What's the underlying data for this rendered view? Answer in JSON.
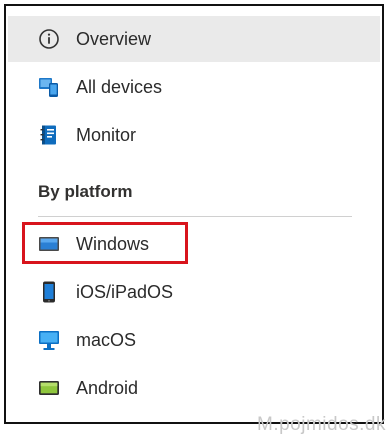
{
  "nav": {
    "items": [
      {
        "label": "Overview",
        "icon": "info-icon",
        "selected": true
      },
      {
        "label": "All devices",
        "icon": "devices-icon",
        "selected": false
      },
      {
        "label": "Monitor",
        "icon": "monitor-book-icon",
        "selected": false
      }
    ],
    "section_header": "By platform",
    "platforms": [
      {
        "label": "Windows",
        "icon": "windows-device-icon",
        "highlighted": true
      },
      {
        "label": "iOS/iPadOS",
        "icon": "phone-icon",
        "highlighted": false
      },
      {
        "label": "macOS",
        "icon": "mac-monitor-icon",
        "highlighted": false
      },
      {
        "label": "Android",
        "icon": "android-device-icon",
        "highlighted": false
      }
    ]
  },
  "colors": {
    "selected_bg": "#eaeaea",
    "highlight_border": "#d8141c",
    "icon_blue": "#0078d4",
    "android_green": "#8fc63d"
  },
  "watermark": "M.pojmidos.dk"
}
